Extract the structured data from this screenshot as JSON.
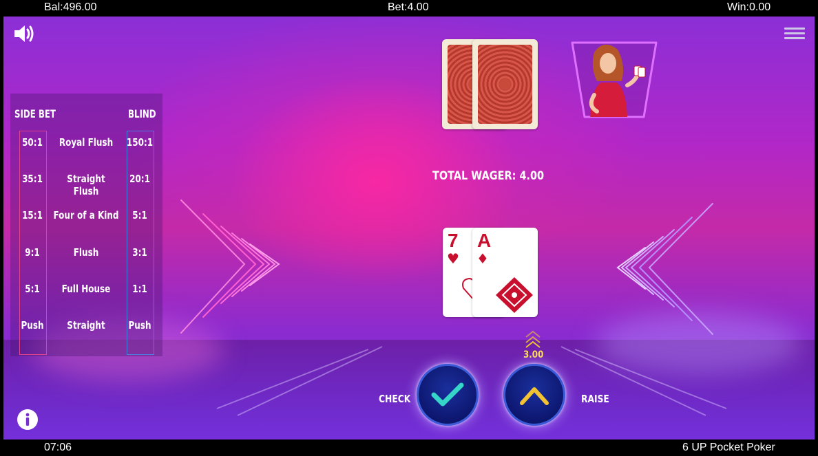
{
  "header": {
    "balance": "Bal:496.00",
    "bet": "Bet:4.00",
    "win": "Win:0.00"
  },
  "footer": {
    "clock": "07:06",
    "game_title": "6 UP Pocket Poker"
  },
  "paytable": {
    "side_bet_header": "SIDE BET",
    "blind_header": "BLIND",
    "rows": [
      {
        "side": "50:1",
        "hand": "Royal Flush",
        "blind": "150:1"
      },
      {
        "side": "35:1",
        "hand": "Straight Flush",
        "blind": "20:1"
      },
      {
        "side": "15:1",
        "hand": "Four of a Kind",
        "blind": "5:1"
      },
      {
        "side": "9:1",
        "hand": "Flush",
        "blind": "3:1"
      },
      {
        "side": "5:1",
        "hand": "Full House",
        "blind": "1:1"
      },
      {
        "side": "Push",
        "hand": "Straight",
        "blind": "Push"
      }
    ]
  },
  "table": {
    "total_wager": "TOTAL WAGER: 4.00",
    "player_cards": [
      {
        "rank": "7",
        "suit": "♥"
      },
      {
        "rank": "A",
        "suit": "♦"
      }
    ]
  },
  "actions": {
    "check_label": "CHECK",
    "raise_label": "RAISE",
    "raise_amount": "3.00"
  },
  "icons": {
    "sound": "speaker-icon",
    "menu": "hamburger-menu-icon",
    "info": "info-icon",
    "check": "checkmark-icon",
    "raise": "chevron-up-icon"
  },
  "colors": {
    "side_bet_box": "#e0448c",
    "blind_box": "#4a7fe0",
    "card_red": "#c8102e",
    "check_mark": "#35d6c8",
    "raise_chevron": "#f2c233"
  }
}
